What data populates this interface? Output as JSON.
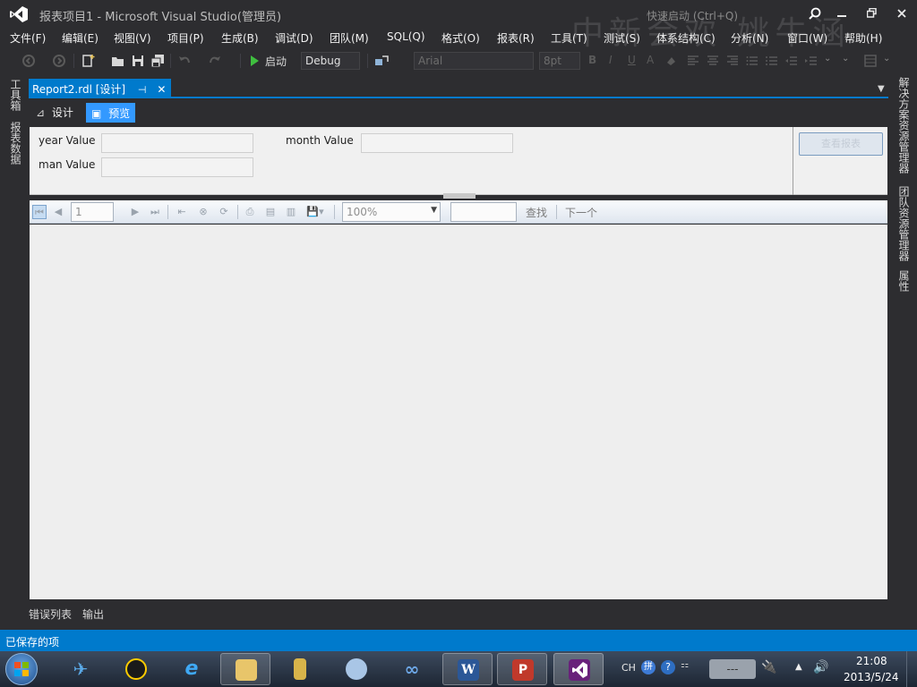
{
  "window": {
    "title": "报表项目1 - Microsoft Visual Studio(管理员)",
    "quick_launch_placeholder": "快速启动 (Ctrl+Q)",
    "watermark": "中新会欢 姚牛涵"
  },
  "menu": {
    "items": [
      "文件(F)",
      "编辑(E)",
      "视图(V)",
      "项目(P)",
      "生成(B)",
      "调试(D)",
      "团队(M)",
      "SQL(Q)",
      "格式(O)",
      "报表(R)",
      "工具(T)",
      "测试(S)",
      "体系结构(C)",
      "分析(N)",
      "窗口(W)",
      "帮助(H)"
    ]
  },
  "toolbar": {
    "start_label": "启动",
    "config_value": "Debug",
    "font_value": "Arial",
    "size_value": "8pt"
  },
  "left_tabs": [
    "工具箱",
    "报表数据"
  ],
  "right_tabs": [
    "解决方案资源管理器",
    "团队资源管理器",
    "属性"
  ],
  "document": {
    "tab_label": "Report2.rdl [设计]",
    "design_label": "设计",
    "preview_label": "预览"
  },
  "parameters": {
    "year_label": "year Value",
    "month_label": "month Value",
    "man_label": "man Value",
    "view_report_label": "查看报表"
  },
  "report_toolbar": {
    "page_value": "1",
    "zoom_value": "100%",
    "find_label": "查找",
    "next_label": "下一个"
  },
  "bottom_tabs": [
    "错误列表",
    "输出"
  ],
  "status": {
    "text": "已保存的项"
  },
  "taskbar": {
    "ime": "CH",
    "tray_box": "---",
    "time": "21:08",
    "date": "2013/5/24"
  },
  "colors": {
    "accent": "#007acc",
    "ide_background": "#2d2d30",
    "preview_tab": "#3399ff"
  }
}
